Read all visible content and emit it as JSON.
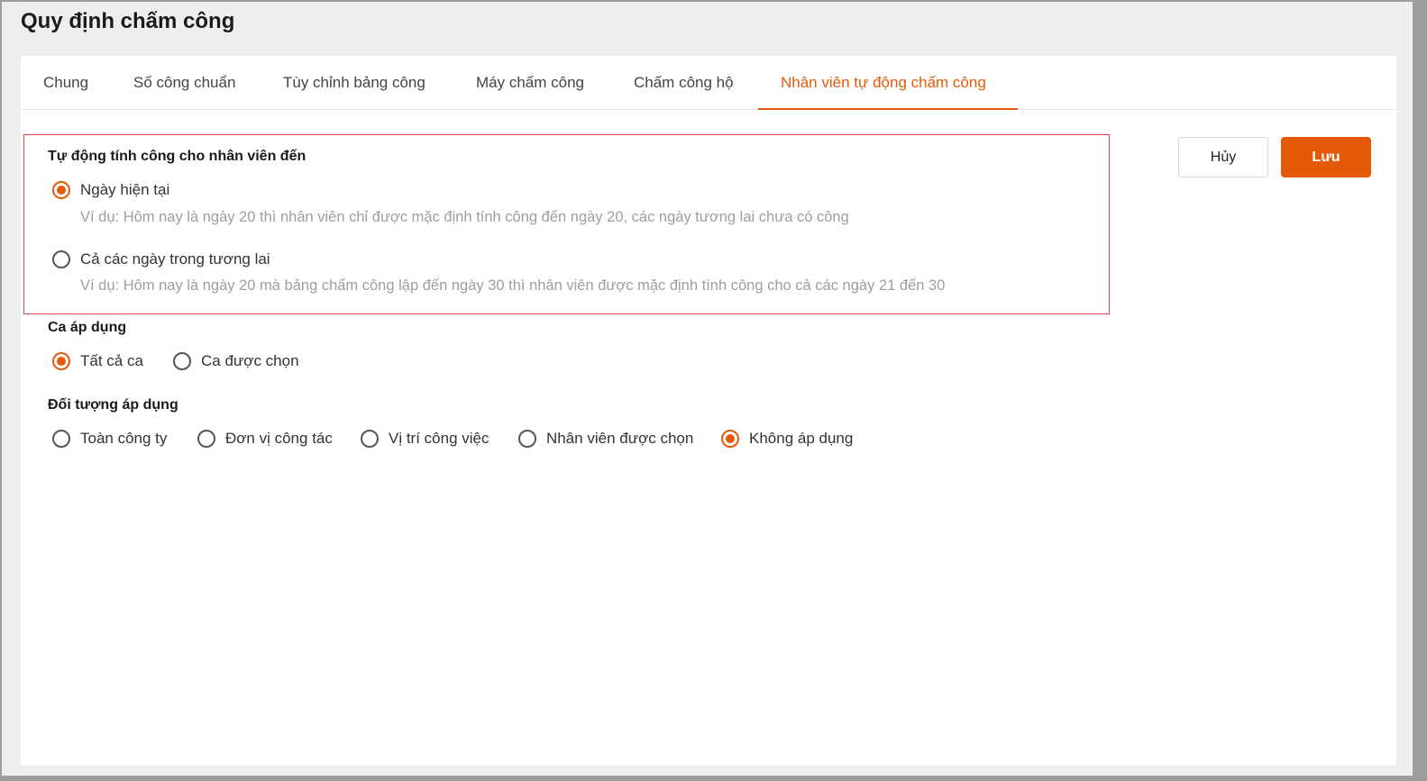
{
  "title": "Quy định chấm công",
  "tabs": [
    "Chung",
    "Số công chuẩn",
    "Tùy chỉnh bảng công",
    "Máy chấm công",
    "Chấm công hộ",
    "Nhân viên tự động chấm công"
  ],
  "active_tab": "Nhân viên tự động chấm công",
  "buttons": {
    "cancel": "Hủy",
    "save": "Lưu"
  },
  "auto": {
    "heading": "Tự động tính công cho nhân viên đến",
    "options": [
      {
        "label": "Ngày hiện tại",
        "hint": "Ví dụ: Hôm nay là ngày 20 thì nhân viên chỉ được mặc định tính công đến ngày 20, các ngày tương lai chưa có công",
        "selected": true
      },
      {
        "label": "Cả các ngày trong tương lai",
        "hint": "Ví dụ: Hôm nay là ngày 20 mà bảng chấm công lập đến ngày 30 thì nhân viên được mặc định tính công cho cả các ngày 21 đến 30",
        "selected": false
      }
    ]
  },
  "shift": {
    "heading": "Ca áp dụng",
    "options": [
      {
        "label": "Tất cả ca",
        "selected": true
      },
      {
        "label": "Ca được chọn",
        "selected": false
      }
    ]
  },
  "target": {
    "heading": "Đối tượng áp dụng",
    "options": [
      {
        "label": "Toàn công ty",
        "selected": false
      },
      {
        "label": "Đơn vị công tác",
        "selected": false
      },
      {
        "label": "Vị trí công việc",
        "selected": false
      },
      {
        "label": "Nhân viên được chọn",
        "selected": false
      },
      {
        "label": "Không áp dụng",
        "selected": true
      }
    ]
  },
  "colors": {
    "accent": "#e55a0a",
    "highlight_border": "#d9474a"
  }
}
